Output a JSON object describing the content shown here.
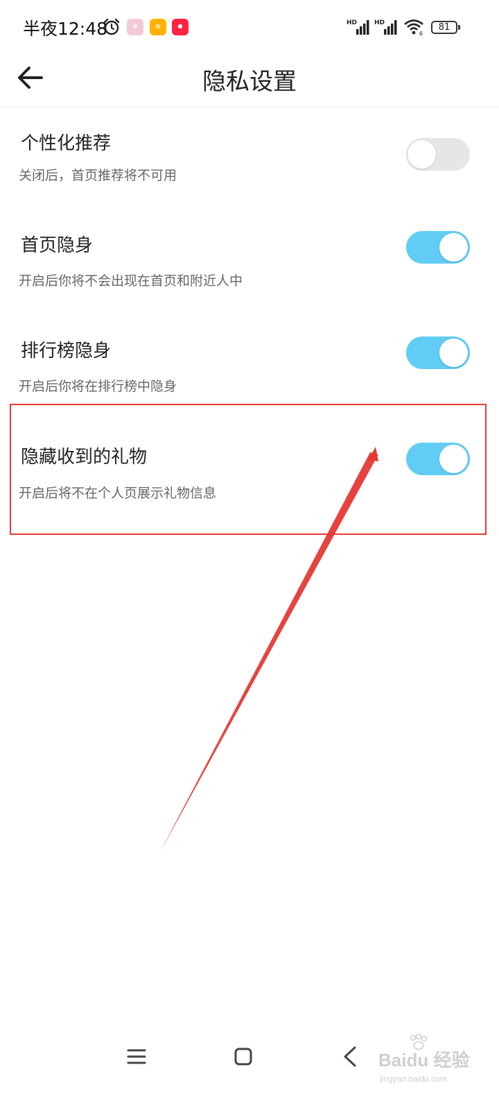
{
  "status_bar": {
    "time": "半夜12:48",
    "battery": "81",
    "signal_labels": [
      "HD",
      "HD"
    ],
    "wifi_label": "6",
    "app_icons": [
      "起点读书",
      "小说",
      "小红书"
    ]
  },
  "header": {
    "title": "隐私设置",
    "back_icon": "arrow-left-icon"
  },
  "settings": [
    {
      "title": "个性化推荐",
      "description": "关闭后，首页推荐将不可用",
      "enabled": false
    },
    {
      "title": "首页隐身",
      "description": "开启后你将不会出现在首页和附近人中",
      "enabled": true
    },
    {
      "title": "排行榜隐身",
      "description": "开启后你将在排行榜中隐身",
      "enabled": true
    },
    {
      "title": "隐藏收到的礼物",
      "description": "开启后将不在个人页展示礼物信息",
      "enabled": true
    }
  ],
  "annotation": {
    "highlighted_item": "隐藏收到的礼物",
    "color": "#e53935"
  },
  "nav_bar": {
    "buttons": [
      "menu-icon",
      "home-icon",
      "back-icon"
    ]
  },
  "watermark": {
    "brand": "Bai",
    "brand_suffix": "经验",
    "url": "jingyan.baidu.com"
  },
  "colors": {
    "toggle_on": "#62cdf4",
    "toggle_off": "#e6e6e6"
  }
}
